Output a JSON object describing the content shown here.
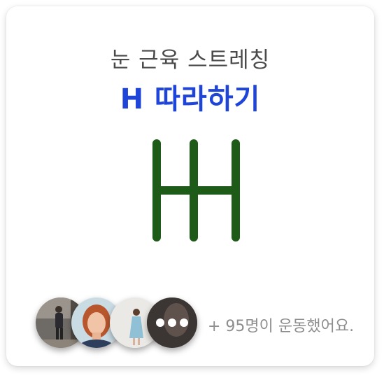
{
  "card": {
    "subtitle": "눈 근육 스트레칭",
    "title": "H 따라하기",
    "graphic_icon": "h-letter-shape-icon",
    "colors": {
      "title": "#1f45d8",
      "graphic": "#1e5a18",
      "subtitle": "#4a4a4a"
    }
  },
  "participants": {
    "avatars": [
      "avatar-person-walking",
      "avatar-red-hair-woman",
      "avatar-woman-in-dress",
      "avatar-dark-portrait"
    ],
    "more_icon": "ellipsis-icon",
    "count_text": "+ 95명이 운동했어요."
  }
}
